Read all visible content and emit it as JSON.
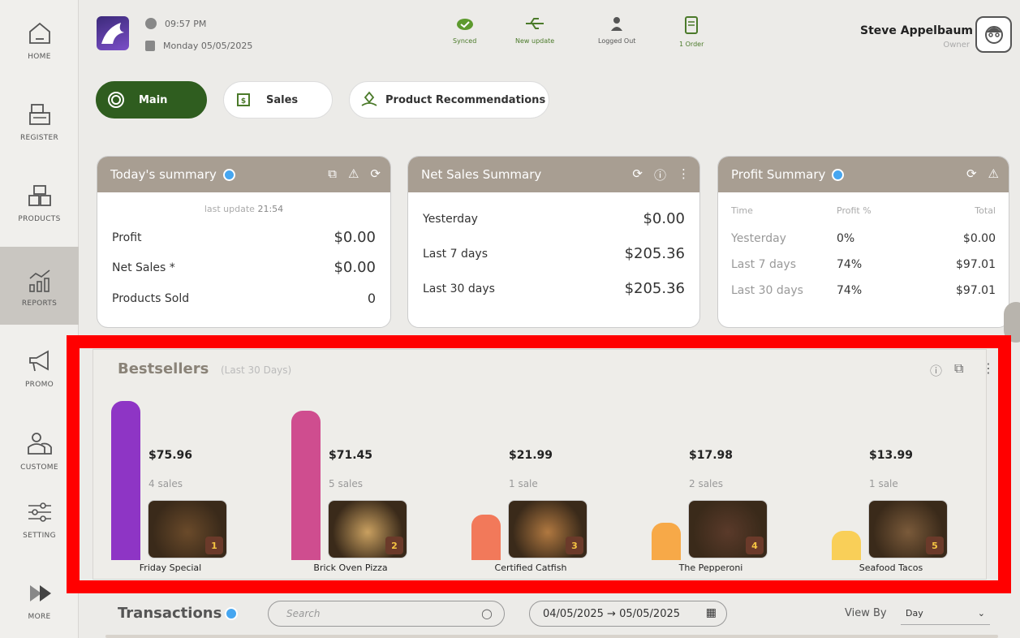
{
  "sidebar": {
    "items": [
      {
        "label": "HOME",
        "icon": "home-icon"
      },
      {
        "label": "REGISTER",
        "icon": "register-icon"
      },
      {
        "label": "PRODUCTS",
        "icon": "products-icon"
      },
      {
        "label": "REPORTS",
        "icon": "reports-icon",
        "active": true
      },
      {
        "label": "PROMO",
        "icon": "megaphone-icon"
      },
      {
        "label": "CUSTOME",
        "icon": "customers-icon"
      },
      {
        "label": "SETTING",
        "icon": "sliders-icon"
      },
      {
        "label": "MORE",
        "icon": "more-icon"
      }
    ]
  },
  "header": {
    "time": "09:57 PM",
    "date": "Monday 05/05/2025",
    "statuses": [
      {
        "label": "Synced",
        "icon": "check-cloud-icon"
      },
      {
        "label": "New update",
        "icon": "usb-icon"
      },
      {
        "label": "Logged Out",
        "icon": "person-icon"
      },
      {
        "label": "1 Order",
        "icon": "receipt-icon"
      }
    ],
    "user_name": "Steve Appelbaum",
    "user_role": "Owner"
  },
  "tabs": [
    {
      "label": "Main",
      "icon": "spiral-icon"
    },
    {
      "label": "Sales",
      "icon": "cart-icon"
    },
    {
      "label": "Product Recommendations",
      "icon": "hand-gem-icon"
    }
  ],
  "today_summary": {
    "title": "Today's summary",
    "last_update_label": "last update",
    "last_update_time": "21:54",
    "rows": [
      {
        "label": "Profit",
        "value": "$0.00"
      },
      {
        "label": "Net Sales *",
        "value": "$0.00"
      },
      {
        "label": "Products Sold",
        "value": "0"
      }
    ]
  },
  "net_sales": {
    "title": "Net Sales Summary",
    "rows": [
      {
        "label": "Yesterday",
        "value": "$0.00"
      },
      {
        "label": "Last 7 days",
        "value": "$205.36"
      },
      {
        "label": "Last 30 days",
        "value": "$205.36"
      }
    ]
  },
  "profit_summary": {
    "title": "Profit Summary",
    "headers": [
      "Time",
      "Profit %",
      "Total"
    ],
    "rows": [
      {
        "label": "Yesterday",
        "pct": "0%",
        "total": "$0.00"
      },
      {
        "label": "Last 7 days",
        "pct": "74%",
        "total": "$97.01"
      },
      {
        "label": "Last 30 days",
        "pct": "74%",
        "total": "$97.01"
      }
    ]
  },
  "bestsellers": {
    "title": "Bestsellers",
    "subtitle": "(Last 30 Days)",
    "items": [
      {
        "name": "Friday Special",
        "price": "$75.96",
        "sales": "4 sales",
        "rank": "1",
        "value": 75.96,
        "color": "#8e35c5"
      },
      {
        "name": "Brick Oven Pizza",
        "price": "$71.45",
        "sales": "5 sales",
        "rank": "2",
        "value": 71.45,
        "color": "#cf4d8f"
      },
      {
        "name": "Certified Catfish",
        "price": "$21.99",
        "sales": "1 sale",
        "rank": "3",
        "value": 21.99,
        "color": "#f2795a"
      },
      {
        "name": "The Pepperoni",
        "price": "$17.98",
        "sales": "2 sales",
        "rank": "4",
        "value": 17.98,
        "color": "#f7a948"
      },
      {
        "name": "Seafood Tacos",
        "price": "$13.99",
        "sales": "1 sale",
        "rank": "5",
        "value": 13.99,
        "color": "#f9cf58"
      }
    ]
  },
  "transactions": {
    "title": "Transactions",
    "search_placeholder": "Search",
    "date_range": "04/05/2025 → 05/05/2025",
    "view_by_label": "View By",
    "view_by_value": "Day"
  }
}
